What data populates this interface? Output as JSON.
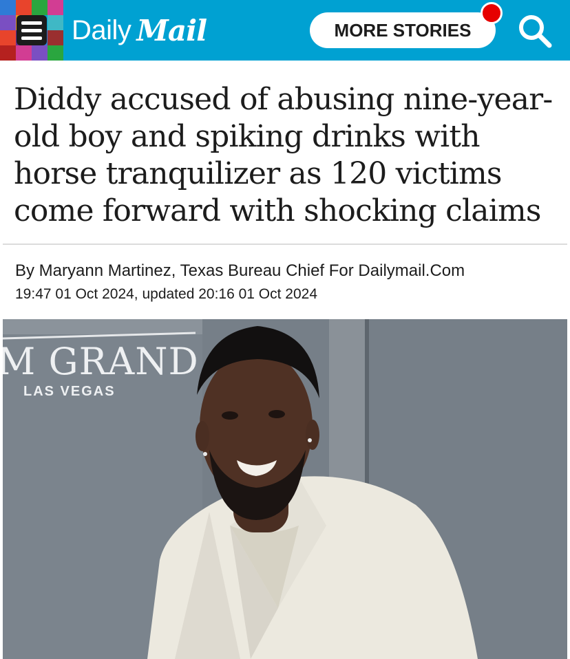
{
  "header": {
    "logo_daily": "Daily",
    "logo_mail": "Mail",
    "more_stories_label": "MORE STORIES",
    "brand_color": "#00a1d2",
    "notification_color": "#e60000",
    "icons": [
      "menu-icon",
      "search-icon"
    ]
  },
  "article": {
    "headline": "Diddy accused of abusing nine-year-old boy and spiking drinks with horse tranquilizer as 120 victims come forward with shocking claims",
    "byline": "By Maryann Martinez, Texas Bureau Chief For Dailymail.Com",
    "dateline": "19:47 01 Oct 2024, updated 20:16 01 Oct 2024"
  },
  "photo": {
    "sign_text": "M GRAND",
    "sign_subtext": "LAS VEGAS"
  }
}
